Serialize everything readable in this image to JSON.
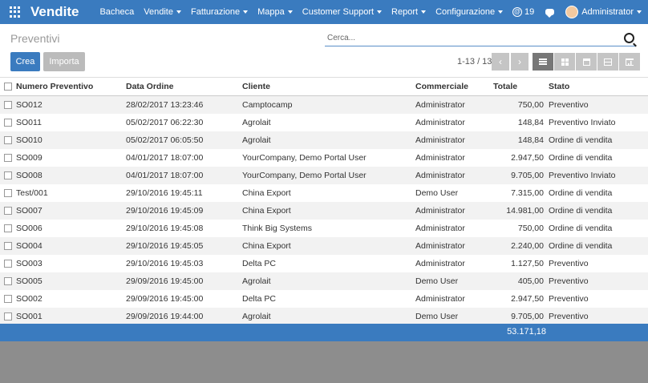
{
  "navbar": {
    "app_name": "Vendite",
    "menu": [
      {
        "label": "Bacheca",
        "dropdown": false
      },
      {
        "label": "Vendite",
        "dropdown": true
      },
      {
        "label": "Fatturazione",
        "dropdown": true
      },
      {
        "label": "Mappa",
        "dropdown": true
      },
      {
        "label": "Customer Support",
        "dropdown": true
      },
      {
        "label": "Report",
        "dropdown": true
      },
      {
        "label": "Configurazione",
        "dropdown": true
      }
    ],
    "notifications_count": "19",
    "user": "Administrator"
  },
  "control_panel": {
    "title": "Preventivi",
    "search_placeholder": "Cerca...",
    "create_label": "Crea",
    "import_label": "Importa",
    "pager": "1-13 / 13"
  },
  "table": {
    "columns": [
      "Numero Preventivo",
      "Data Ordine",
      "Cliente",
      "Commerciale",
      "Totale",
      "Stato"
    ],
    "rows": [
      [
        "SO012",
        "28/02/2017 13:23:46",
        "Camptocamp",
        "Administrator",
        "750,00",
        "Preventivo"
      ],
      [
        "SO011",
        "05/02/2017 06:22:30",
        "Agrolait",
        "Administrator",
        "148,84",
        "Preventivo Inviato"
      ],
      [
        "SO010",
        "05/02/2017 06:05:50",
        "Agrolait",
        "Administrator",
        "148,84",
        "Ordine di vendita"
      ],
      [
        "SO009",
        "04/01/2017 18:07:00",
        "YourCompany, Demo Portal User",
        "Administrator",
        "2.947,50",
        "Ordine di vendita"
      ],
      [
        "SO008",
        "04/01/2017 18:07:00",
        "YourCompany, Demo Portal User",
        "Administrator",
        "9.705,00",
        "Preventivo Inviato"
      ],
      [
        "Test/001",
        "29/10/2016 19:45:11",
        "China Export",
        "Demo User",
        "7.315,00",
        "Ordine di vendita"
      ],
      [
        "SO007",
        "29/10/2016 19:45:09",
        "China Export",
        "Administrator",
        "14.981,00",
        "Ordine di vendita"
      ],
      [
        "SO006",
        "29/10/2016 19:45:08",
        "Think Big Systems",
        "Administrator",
        "750,00",
        "Ordine di vendita"
      ],
      [
        "SO004",
        "29/10/2016 19:45:05",
        "China Export",
        "Administrator",
        "2.240,00",
        "Ordine di vendita"
      ],
      [
        "SO003",
        "29/10/2016 19:45:03",
        "Delta PC",
        "Administrator",
        "1.127,50",
        "Preventivo"
      ],
      [
        "SO005",
        "29/09/2016 19:45:00",
        "Agrolait",
        "Demo User",
        "405,00",
        "Preventivo"
      ],
      [
        "SO002",
        "29/09/2016 19:45:00",
        "Delta PC",
        "Administrator",
        "2.947,50",
        "Preventivo"
      ],
      [
        "SO001",
        "29/09/2016 19:44:00",
        "Agrolait",
        "Demo User",
        "9.705,00",
        "Preventivo"
      ]
    ],
    "total": "53.171,18"
  },
  "colors": {
    "brand": "#3a7bbf",
    "muted_button": "#c5c5c5"
  }
}
